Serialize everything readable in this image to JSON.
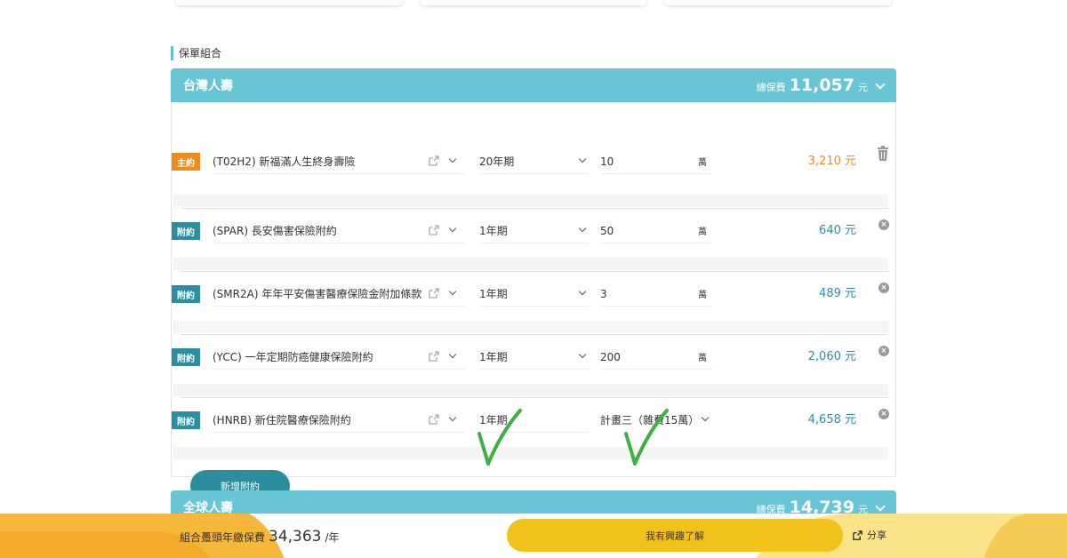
{
  "section_title": "保單組合",
  "companies": [
    {
      "name": "台灣人壽",
      "total_label": "總保費",
      "total_amount": "11,057",
      "total_unit": "元",
      "rows": [
        {
          "badge": "主約",
          "type": "main",
          "name": "(T02H2) 新福滿人生終身壽險",
          "term": "20年期",
          "amount": "10",
          "amount_unit": "萬",
          "premium": "3,210 元"
        },
        {
          "badge": "附約",
          "type": "rider",
          "name": "(SPAR) 長安傷害保險附約",
          "term": "1年期",
          "amount": "50",
          "amount_unit": "萬",
          "premium": "640 元"
        },
        {
          "badge": "附約",
          "type": "rider",
          "name": "(SMR2A) 年年平安傷害醫療保險金附加條款",
          "term": "1年期",
          "amount": "3",
          "amount_unit": "萬",
          "premium": "489 元"
        },
        {
          "badge": "附約",
          "type": "rider",
          "name": "(YCC) 一年定期防癌健康保險附約",
          "term": "1年期",
          "amount": "200",
          "amount_unit": "萬",
          "premium": "2,060 元"
        },
        {
          "badge": "附約",
          "type": "rider",
          "name": "(HNRB) 新住院醫療保險附約",
          "term": "1年期",
          "amount": "計畫三（雜費15萬）",
          "amount_unit": "",
          "premium": "4,658 元"
        }
      ],
      "add_button": "新增附約"
    },
    {
      "name": "全球人壽",
      "total_label": "總保費",
      "total_amount": "14,739",
      "total_unit": "元"
    }
  ],
  "bottom_bar": {
    "label": "組合躉頭年繳保費",
    "amount": "34,363",
    "unit": "/年",
    "cta": "我有興趣了解",
    "share": "分享"
  },
  "colors": {
    "header": "#67c5d5",
    "main_badge": "#f08b1e",
    "rider_badge": "#2b8fa0",
    "cta": "#f1c21b",
    "check": "#3cb043"
  }
}
